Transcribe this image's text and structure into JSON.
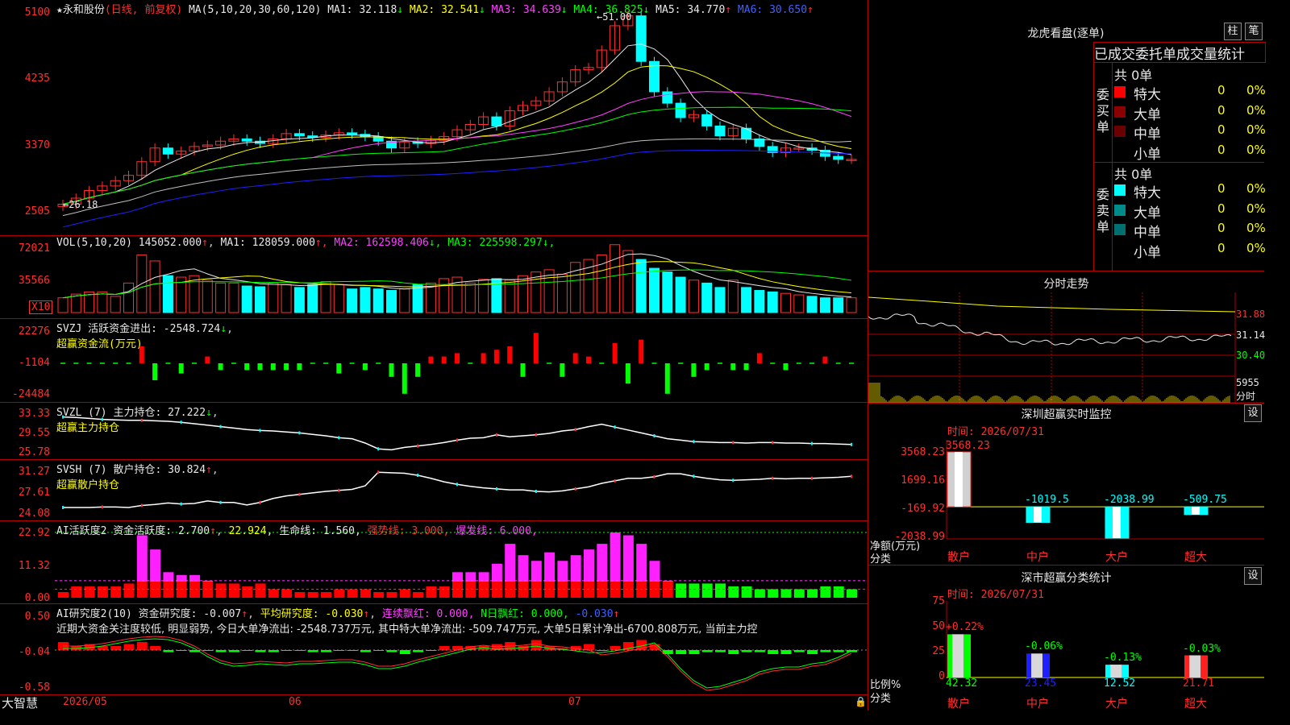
{
  "app": {
    "brand": "大智慧"
  },
  "kline": {
    "title": "永和股份",
    "mode": "(日线, 前复权)",
    "ma_label": "MA(5,10,20,30,60,120)",
    "ma": [
      {
        "name": "MA1:",
        "value": "32.118",
        "arrow": "↓",
        "color": "#e8e8e8"
      },
      {
        "name": "MA2:",
        "value": "32.541",
        "arrow": "↓",
        "color": "#ffff00"
      },
      {
        "name": "MA3:",
        "value": "34.639",
        "arrow": "↓",
        "color": "#ff40ff"
      },
      {
        "name": "MA4:",
        "value": "36.825",
        "arrow": "↓",
        "color": "#00ff00"
      },
      {
        "name": "MA5:",
        "value": "34.770",
        "arrow": "↑",
        "color": "#e8e8e8"
      },
      {
        "name": "MA6:",
        "value": "30.650",
        "arrow": "↑",
        "color": "#4060ff"
      }
    ],
    "y_ticks": [
      "5100",
      "4235",
      "3370",
      "2505"
    ],
    "high_label": "51.00",
    "low_label": "26.18"
  },
  "vol": {
    "label": "VOL(5,10,20)",
    "value": "145052.000",
    "ma": [
      {
        "name": "MA1:",
        "value": "128059.000",
        "arrow": "↑",
        "color": "#e8e8e8"
      },
      {
        "name": "MA2:",
        "value": "162598.406",
        "arrow": "↓",
        "color": "#ff40ff"
      },
      {
        "name": "MA3:",
        "value": "225598.297",
        "arrow": "↓",
        "color": "#00ff00"
      }
    ],
    "y_ticks": [
      "72021",
      "35566"
    ],
    "unit": "X10"
  },
  "svzj": {
    "label": "SVZJ  活跃资金进出:",
    "value": "-2548.724",
    "arrow": "↓",
    "sub": "超赢资金流(万元)",
    "y_ticks": [
      "22276",
      "-1104",
      "-24484"
    ]
  },
  "svzl": {
    "label": "SVZL (7) 主力持仓:",
    "value": "27.222",
    "arrow": "↓",
    "sub": "超赢主力持仓",
    "y_ticks": [
      "33.33",
      "29.55",
      "25.78"
    ]
  },
  "svsh": {
    "label": "SVSH (7) 散户持仓:",
    "value": "30.824",
    "arrow": "↑",
    "sub": "超赢散户持仓",
    "y_ticks": [
      "31.27",
      "27.61",
      "24.08"
    ]
  },
  "ai_active": {
    "label": "AI活跃度2 资金活跃度:",
    "value": "2.700",
    "arrow": "↑",
    "v2": "22.924",
    "life": "生命线: 1.560,",
    "strong": "强势线: 3.000,",
    "burst": "爆发线: 6.000,",
    "y_ticks": [
      "22.92",
      "11.32",
      "0.00"
    ]
  },
  "ai_research": {
    "label": "AI研究度2(10) 资金研究度:",
    "value": "-0.007",
    "avg": "平均研究度: -0.030",
    "red": "连续飘红: 0.000,",
    "nred": "N日飘红: 0.000,",
    "last": "-0.030",
    "comment": "近期大资金关注度较低, 明显弱势, 今日大单净流出: -2548.737万元, 其中特大单净流出: -509.747万元, 大单5日累计净出-6700.808万元, 当前主力控",
    "y_ticks": [
      "0.50",
      "-0.04",
      "-0.58"
    ]
  },
  "x_axis": {
    "labels": [
      "2026/05",
      "06",
      "07"
    ]
  },
  "dragon": {
    "title": "龙虎看盘(逐单)",
    "btn1": "柱",
    "btn2": "笔",
    "tabs": "已成交委托单成交量统计",
    "buy_side": "委买单",
    "sell_side": "委卖单",
    "buy_total": "共 0单",
    "sell_total": "共 0单",
    "rows": [
      {
        "name": "特大",
        "count": "0",
        "pct": "0%"
      },
      {
        "name": "大单",
        "count": "0",
        "pct": "0%"
      },
      {
        "name": "中单",
        "count": "0",
        "pct": "0%"
      },
      {
        "name": "小单",
        "count": "0",
        "pct": "0%"
      }
    ],
    "buy_colors": [
      "#ff0000",
      "#8b0000",
      "#6a0000",
      ""
    ],
    "sell_colors": [
      "#00ffff",
      "#008b8b",
      "#007070",
      ""
    ]
  },
  "intraday": {
    "title": "分时走势",
    "ticks": [
      "31.88",
      "31.14",
      "30.40",
      "5955",
      "分时"
    ]
  },
  "sz_monitor": {
    "title": "深圳超赢实时监控",
    "btn": "设",
    "time": "时间: 2026/07/31",
    "y_ticks": [
      "3568.23",
      "1699.16",
      "-169.92",
      "-2038.99"
    ],
    "unit": "净额(万元)",
    "unit2": "分类",
    "bars": [
      {
        "label": "散户",
        "value": "3568.23",
        "num": 3568.23
      },
      {
        "label": "中户",
        "value": "-1019.5",
        "num": -1019.5
      },
      {
        "label": "大户",
        "value": "-2038.99",
        "num": -2038.99
      },
      {
        "label": "超大",
        "value": "-509.75",
        "num": -509.75
      }
    ]
  },
  "sz_class": {
    "title": "深市超赢分类统计",
    "btn": "设",
    "time": "时间: 2026/07/31",
    "y_ticks": [
      "75",
      "50",
      "25",
      "0"
    ],
    "unit": "比例%",
    "unit2": "分类",
    "bars": [
      {
        "label": "散户",
        "change": "+0.22%",
        "ratio": "42.32",
        "num": 42.32,
        "color": "#00ff00"
      },
      {
        "label": "中户",
        "change": "-0.06%",
        "ratio": "23.45",
        "num": 23.45,
        "color": "#2020ff"
      },
      {
        "label": "大户",
        "change": "-0.13%",
        "ratio": "12.52",
        "num": 12.52,
        "color": "#00ffff"
      },
      {
        "label": "超大",
        "change": "-0.03%",
        "ratio": "21.71",
        "num": 21.71,
        "color": "#ff2020"
      }
    ]
  }
}
